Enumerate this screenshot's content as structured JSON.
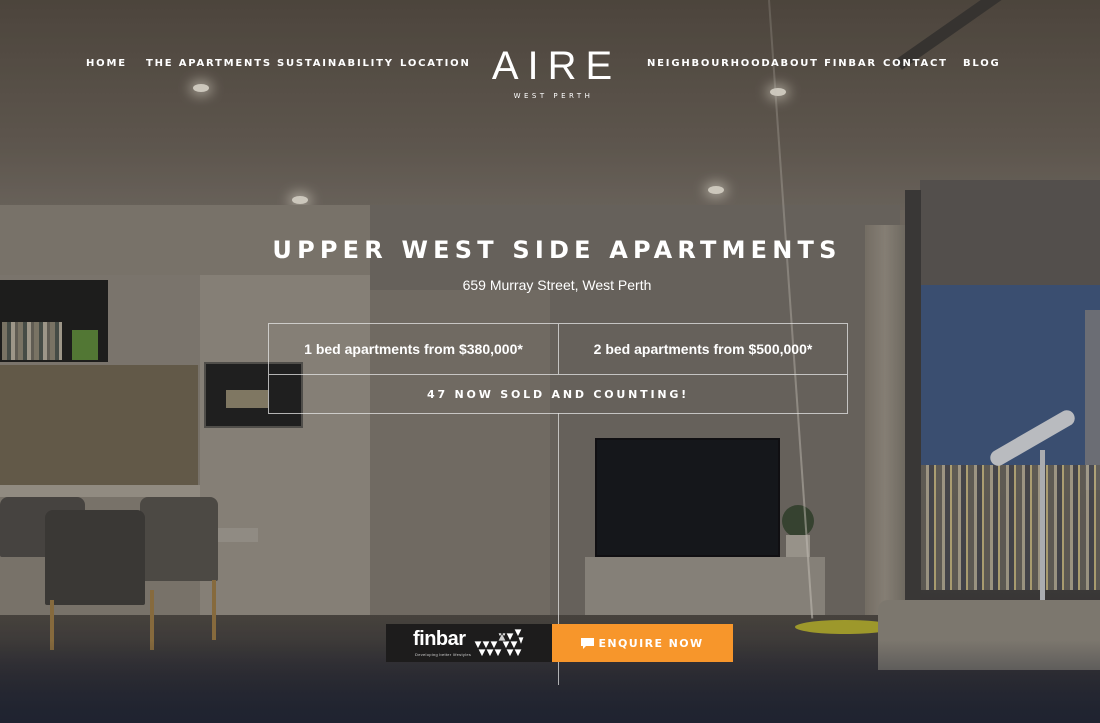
{
  "nav": {
    "left_items": [
      {
        "label": "HOME"
      },
      {
        "label": "THE APARTMENTS"
      },
      {
        "label": "SUSTAINABILITY"
      },
      {
        "label": "LOCATION"
      }
    ],
    "right_items": [
      {
        "label": "NEIGHBOURHOOD"
      },
      {
        "label": "ABOUT FINBAR"
      },
      {
        "label": "CONTACT"
      },
      {
        "label": "BLOG"
      }
    ]
  },
  "logo": {
    "name": "AIRE",
    "subtitle": "WEST PERTH"
  },
  "hero": {
    "title": "UPPER WEST SIDE APARTMENTS",
    "address": "659 Murray Street, West Perth",
    "prices": [
      {
        "label": "1 bed apartments from $380,000*"
      },
      {
        "label": "2 bed apartments from $500,000*"
      }
    ],
    "sold_banner": "47 NOW SOLD AND COUNTING!"
  },
  "cta": {
    "developer_logo": "finbar",
    "developer_tagline": "Developing better lifestyles",
    "enquire_label": "ENQUIRE NOW",
    "enquire_icon": "chat-bubble-icon",
    "enquire_color": "#f7962b"
  }
}
